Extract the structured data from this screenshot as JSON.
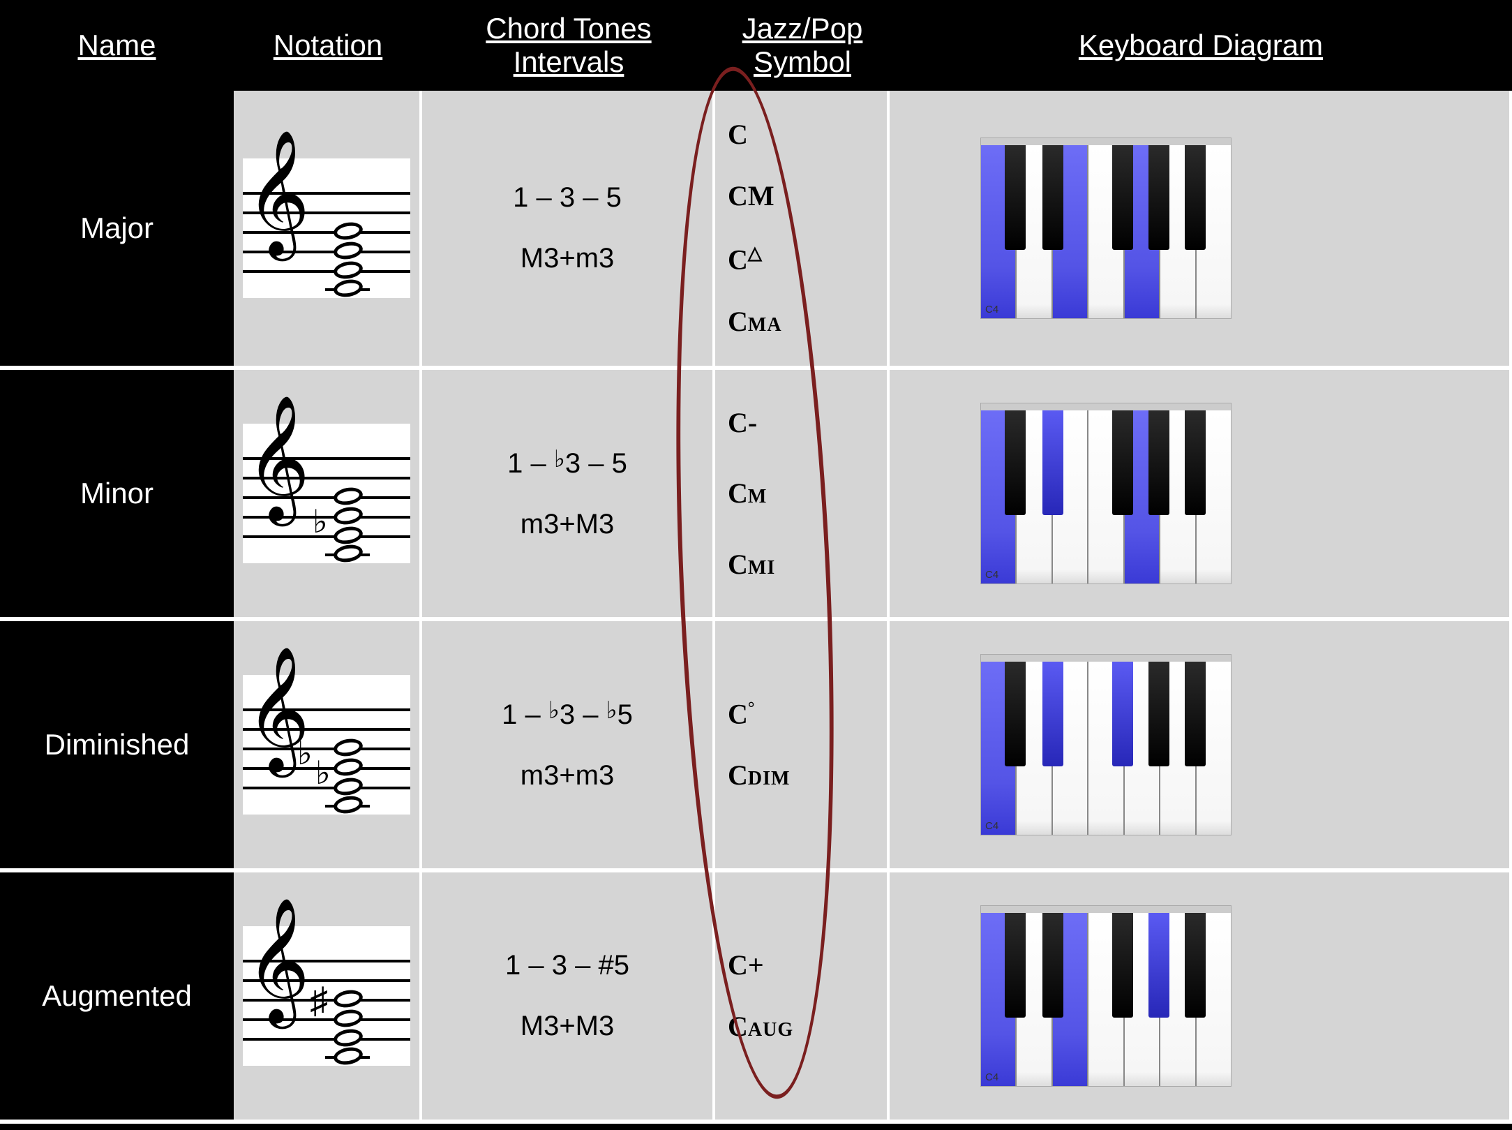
{
  "headers": {
    "name": "Name",
    "notation": "Notation",
    "chord_tones": "Chord Tones\nIntervals",
    "jazz_pop": "Jazz/Pop\nSymbol",
    "keyboard": "Keyboard Diagram"
  },
  "keyboard_label": "C4",
  "chart_data": {
    "type": "table",
    "title": "Triad chord qualities reference",
    "columns": [
      "Name",
      "Notation",
      "Chord Tones Intervals",
      "Jazz/Pop Symbol",
      "Keyboard Diagram"
    ],
    "rows": [
      {
        "name": "Major",
        "chord_tones": "1 – 3 – 5",
        "intervals": "M3+m3",
        "jazz_pop_symbols": [
          "C",
          "CM",
          "C△",
          "Cᴍᴀ"
        ],
        "notation_notes": [
          "C4",
          "E4",
          "G4"
        ],
        "notation_accidentals": [],
        "highlighted_keys": [
          "C4",
          "E4",
          "G4"
        ]
      },
      {
        "name": "Minor",
        "chord_tones": "1 – ♭3 – 5",
        "intervals": "m3+M3",
        "jazz_pop_symbols": [
          "C-",
          "Cᴍ",
          "Cᴍɪ"
        ],
        "notation_notes": [
          "C4",
          "E♭4",
          "G4"
        ],
        "notation_accidentals": [
          "♭ on 3rd"
        ],
        "highlighted_keys": [
          "C4",
          "E♭4",
          "G4"
        ]
      },
      {
        "name": "Diminished",
        "chord_tones": "1 – ♭3 – ♭5",
        "intervals": "m3+m3",
        "jazz_pop_symbols": [
          "C°",
          "Cᴅɪᴍ"
        ],
        "notation_notes": [
          "C4",
          "E♭4",
          "G♭4"
        ],
        "notation_accidentals": [
          "♭ on 3rd",
          "♭ on 5th"
        ],
        "highlighted_keys": [
          "C4",
          "E♭4",
          "G♭4"
        ]
      },
      {
        "name": "Augmented",
        "chord_tones": "1 – 3 – #5",
        "intervals": "M3+M3",
        "jazz_pop_symbols": [
          "C+",
          "Cᴀᴜɢ"
        ],
        "notation_notes": [
          "C4",
          "E4",
          "G♯4"
        ],
        "notation_accidentals": [
          "♯ on 5th"
        ],
        "highlighted_keys": [
          "C4",
          "E4",
          "G♯4"
        ]
      }
    ]
  },
  "rows": {
    "major": {
      "name": "Major",
      "tones": "1 – 3 – 5",
      "iv": "M3+m3",
      "sym1": "C",
      "sym2": "CM",
      "sym3_base": "C",
      "sym3_sup": "△",
      "sym4_base": "C",
      "sym4_caps": "MA"
    },
    "minor": {
      "name": "Minor",
      "tones_a": "1 – ",
      "tones_flat1": "♭",
      "tones_b": "3 – 5",
      "iv": "m3+M3",
      "sym1": "C-",
      "sym2_base": "C",
      "sym2_caps": "M",
      "sym3_base": "C",
      "sym3_caps": "MI"
    },
    "dim": {
      "name": "Diminished",
      "tones_a": "1 – ",
      "tones_flat1": "♭",
      "tones_b": "3 – ",
      "tones_flat2": "♭",
      "tones_c": "5",
      "iv": "m3+m3",
      "sym1_base": "C",
      "sym1_sup": "°",
      "sym2_base": "C",
      "sym2_caps": "DIM"
    },
    "aug": {
      "name": "Augmented",
      "tones": "1 – 3 – #5",
      "iv": "M3+M3",
      "sym1": "C+",
      "sym2_base": "C",
      "sym2_caps": "AUG"
    }
  }
}
